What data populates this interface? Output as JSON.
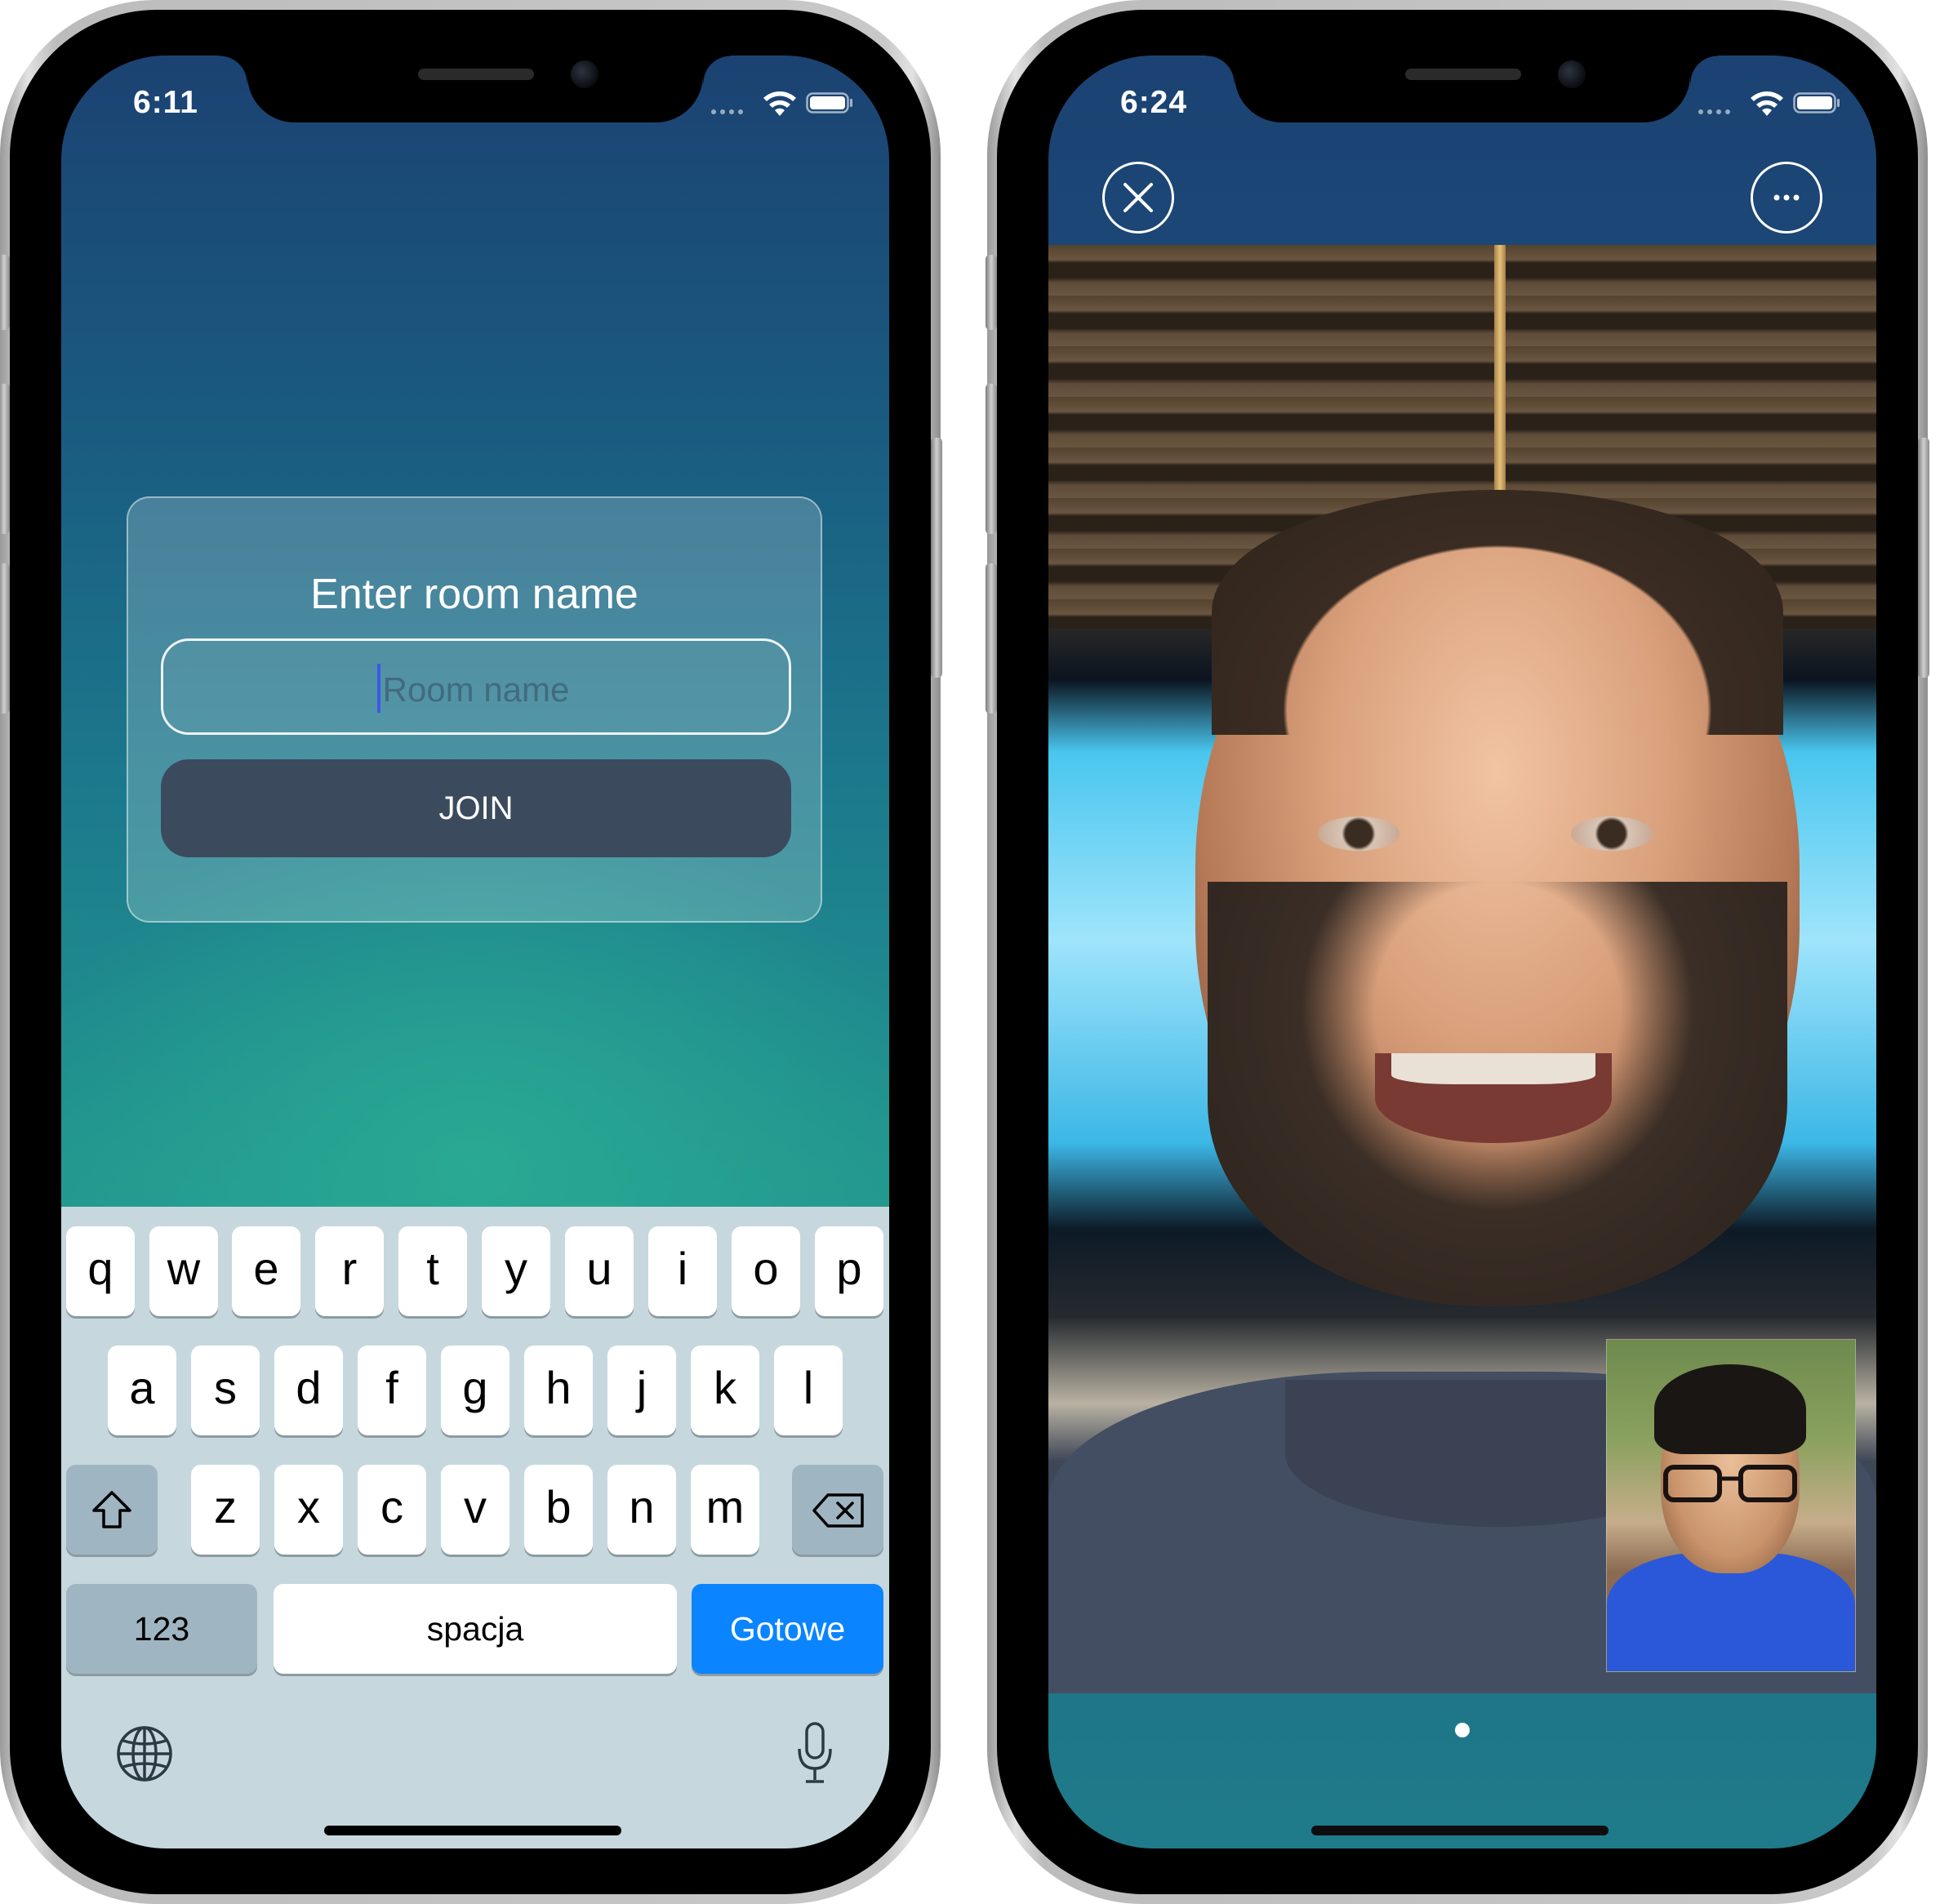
{
  "left_phone": {
    "status": {
      "time": "6:11"
    },
    "card": {
      "title": "Enter room name",
      "input_placeholder": "Room name",
      "input_value": "",
      "join_label": "JOIN"
    },
    "keyboard": {
      "row1": [
        "q",
        "w",
        "e",
        "r",
        "t",
        "y",
        "u",
        "i",
        "o",
        "p"
      ],
      "row2": [
        "a",
        "s",
        "d",
        "f",
        "g",
        "h",
        "j",
        "k",
        "l"
      ],
      "row3": [
        "z",
        "x",
        "c",
        "v",
        "b",
        "n",
        "m"
      ],
      "numbers_label": "123",
      "space_label": "spacja",
      "done_label": "Gotowe",
      "icons": [
        "shift-icon",
        "backspace-icon",
        "globe-icon",
        "microphone-icon"
      ]
    }
  },
  "right_phone": {
    "status": {
      "time": "6:24"
    },
    "toolbar": {
      "icons": [
        "close-icon",
        "more-icon"
      ]
    },
    "video": {
      "main": "remote-participant-video",
      "pip": "local-participant-video"
    },
    "page_indicator": {
      "pages": 1,
      "current": 1
    }
  },
  "colors": {
    "gradient_top": "#1b4272",
    "gradient_mid": "#22a08c",
    "join_button": "#3c4a5e",
    "done_key": "#0a84ff",
    "keyboard_bg": "#c6d8de"
  }
}
